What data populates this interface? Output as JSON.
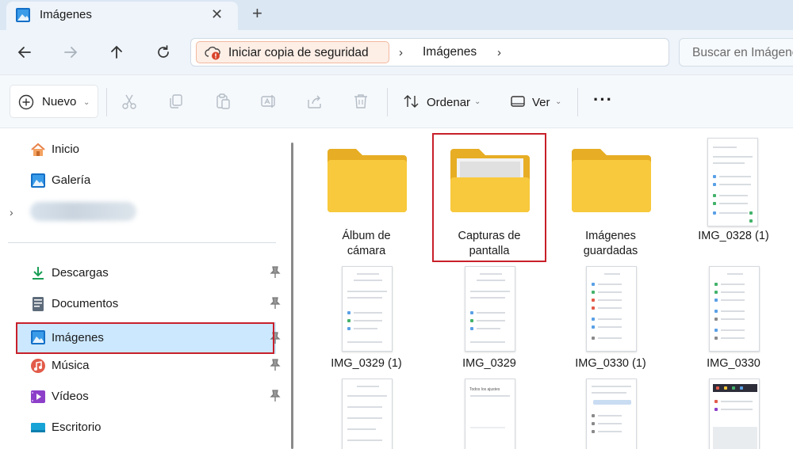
{
  "tab": {
    "title": "Imágenes",
    "close": "✕",
    "new": "+"
  },
  "nav": {
    "backup_label": "Iniciar copia de seguridad",
    "crumb_sep": "›",
    "crumbs": [
      "Imágenes"
    ],
    "search_placeholder": "Buscar en Imágenes"
  },
  "toolbar": {
    "new_label": "Nuevo",
    "sort_label": "Ordenar",
    "view_label": "Ver",
    "more": "···"
  },
  "sidebar": {
    "items_top": [
      {
        "label": "Inicio",
        "icon": "home-icon"
      },
      {
        "label": "Galería",
        "icon": "gallery-icon"
      }
    ],
    "items": [
      {
        "label": "Descargas",
        "icon": "download-icon"
      },
      {
        "label": "Documentos",
        "icon": "documents-icon"
      },
      {
        "label": "Imágenes",
        "icon": "pictures-icon",
        "selected": true
      },
      {
        "label": "Música",
        "icon": "music-icon"
      },
      {
        "label": "Vídeos",
        "icon": "videos-icon"
      },
      {
        "label": "Escritorio",
        "icon": "desktop-icon"
      }
    ]
  },
  "content": {
    "folders": [
      {
        "line1": "Álbum de",
        "line2": "cámara"
      },
      {
        "line1": "Capturas de",
        "line2": "pantalla",
        "highlighted": true
      },
      {
        "line1": "Imágenes",
        "line2": "guardadas"
      }
    ],
    "files": [
      "IMG_0328 (1)",
      "IMG_0329 (1)",
      "IMG_0329",
      "IMG_0330 (1)",
      "IMG_0330"
    ],
    "third_row_second_thumb_text": "Todos los ajustes"
  },
  "colors": {
    "selection_bg": "#cce8ff",
    "highlight_border": "#c8202a",
    "folder_yellow": "#f8c93c"
  }
}
